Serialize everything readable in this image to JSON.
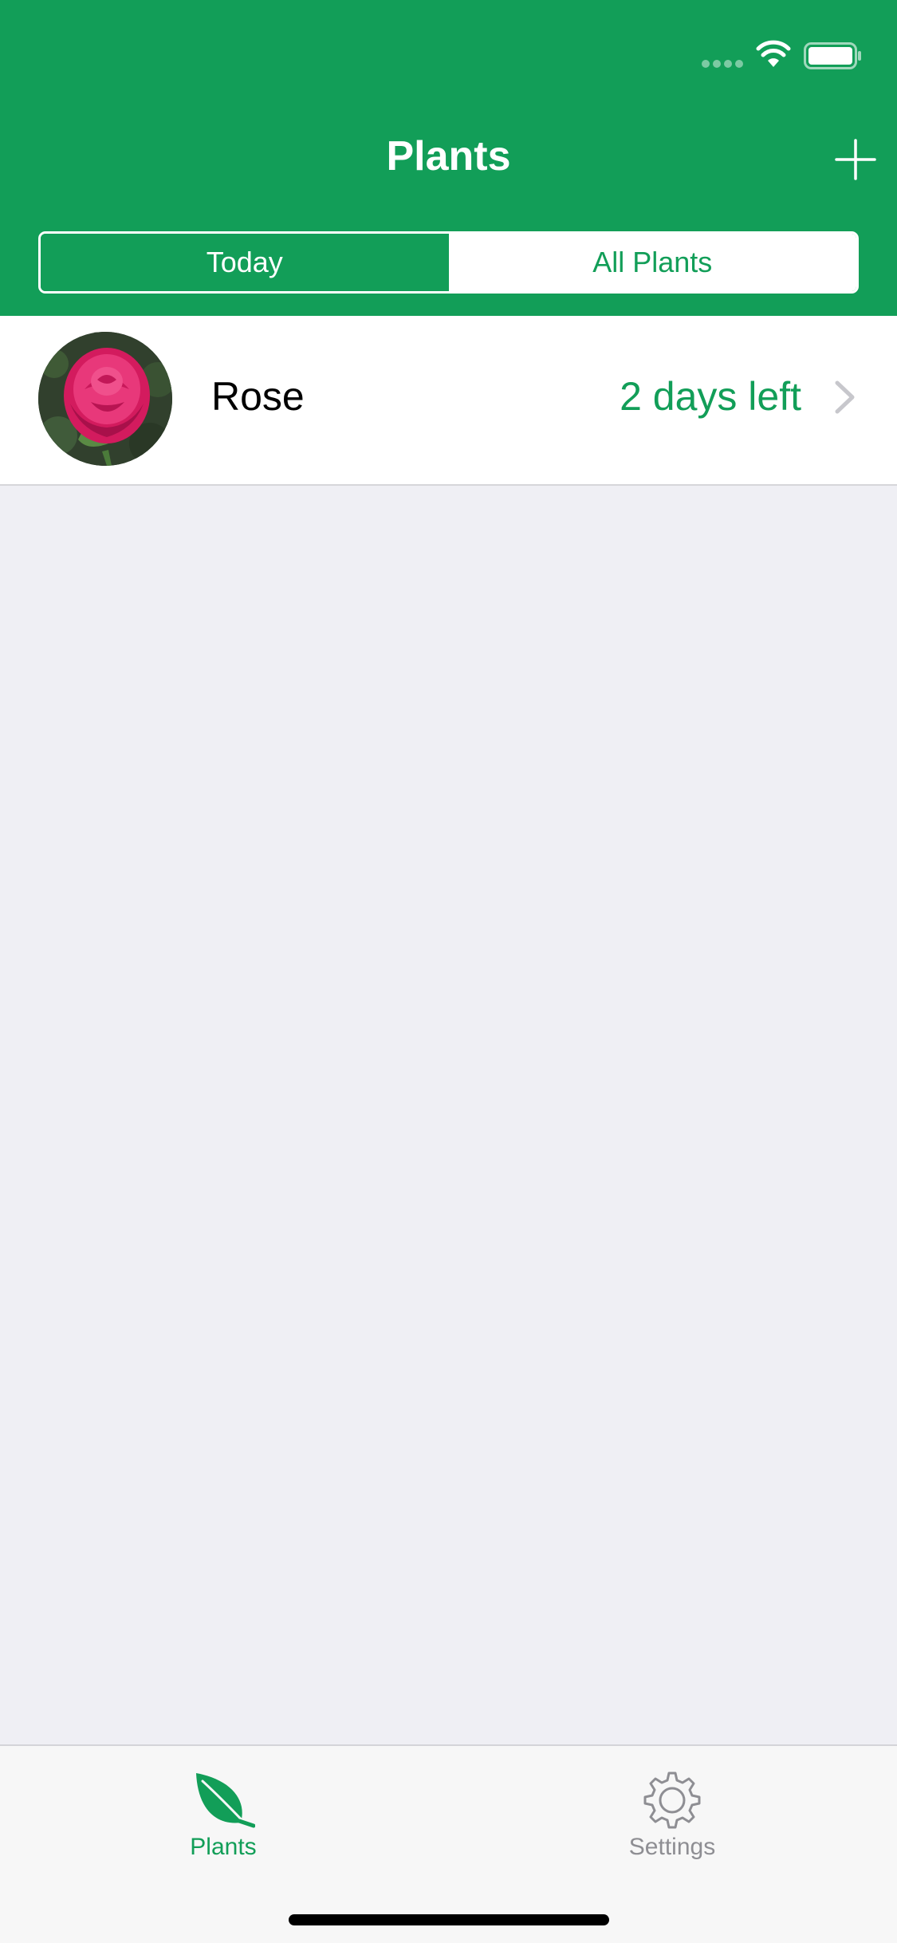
{
  "colors": {
    "brand_green": "#129e58",
    "background": "#efeff4",
    "tab_inactive": "#8e8e93"
  },
  "status_bar": {
    "icons": [
      "signal-dots-icon",
      "wifi-icon",
      "battery-icon"
    ]
  },
  "nav_bar": {
    "title": "Plants",
    "add_icon": "plus-icon"
  },
  "segmented_control": {
    "segments": [
      {
        "label": "Today",
        "selected": true
      },
      {
        "label": "All Plants",
        "selected": false
      }
    ]
  },
  "plants": [
    {
      "name": "Rose",
      "status": "2 days left",
      "photo_icon": "rose-photo",
      "accessory_icon": "chevron-right-icon"
    }
  ],
  "tab_bar": {
    "items": [
      {
        "label": "Plants",
        "icon": "leaf-icon",
        "selected": true
      },
      {
        "label": "Settings",
        "icon": "gear-icon",
        "selected": false
      }
    ]
  }
}
